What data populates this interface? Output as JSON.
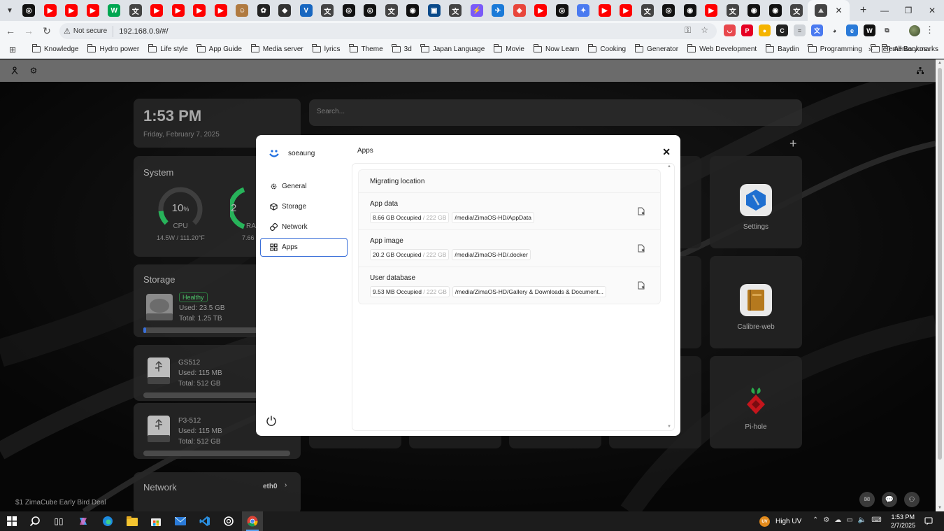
{
  "browser": {
    "pinned_tabs": [
      {
        "icon": "chatgpt-icon",
        "color": "#111111"
      },
      {
        "icon": "youtube-icon",
        "color": "#ff0000"
      },
      {
        "icon": "youtube-icon",
        "color": "#ff0000"
      },
      {
        "icon": "youtube-icon",
        "color": "#ff0000"
      },
      {
        "icon": "webtoon-icon",
        "color": "#00a651"
      },
      {
        "icon": "kanji-icon",
        "color": "#444444"
      },
      {
        "icon": "youtube-icon",
        "color": "#ff0000"
      },
      {
        "icon": "youtube-icon",
        "color": "#ff0000"
      },
      {
        "icon": "youtube-icon",
        "color": "#ff0000"
      },
      {
        "icon": "youtube-icon",
        "color": "#ff0000"
      },
      {
        "icon": "avatar-icon",
        "color": "#b07a40"
      },
      {
        "icon": "openai-icon",
        "color": "#222222"
      },
      {
        "icon": "cat-icon",
        "color": "#333333"
      },
      {
        "icon": "vuetify-icon",
        "color": "#1867c0"
      },
      {
        "icon": "kanji-icon",
        "color": "#444444"
      },
      {
        "icon": "chatgpt-icon",
        "color": "#111111"
      },
      {
        "icon": "chatgpt-icon",
        "color": "#111111"
      },
      {
        "icon": "kanji-icon",
        "color": "#444444"
      },
      {
        "icon": "github-icon",
        "color": "#111111"
      },
      {
        "icon": "screen-icon",
        "color": "#0a4a8a"
      },
      {
        "icon": "kanji-icon",
        "color": "#444444"
      },
      {
        "icon": "vite-icon",
        "color": "#7a5af8"
      },
      {
        "icon": "fly-icon",
        "color": "#1a7ad8"
      },
      {
        "icon": "red-app-icon",
        "color": "#e8463b"
      },
      {
        "icon": "youtube-icon",
        "color": "#ff0000"
      },
      {
        "icon": "chatgpt-icon",
        "color": "#111111"
      },
      {
        "icon": "gemini-icon",
        "color": "#4a7af0"
      },
      {
        "icon": "youtube-icon",
        "color": "#ff0000"
      },
      {
        "icon": "youtube-icon",
        "color": "#ff0000"
      },
      {
        "icon": "kanji-icon",
        "color": "#444444"
      },
      {
        "icon": "chatgpt-icon",
        "color": "#111111"
      },
      {
        "icon": "github-icon",
        "color": "#111111"
      },
      {
        "icon": "youtube-icon",
        "color": "#ff0000"
      },
      {
        "icon": "kanji-icon",
        "color": "#444444"
      },
      {
        "icon": "github-icon",
        "color": "#111111"
      },
      {
        "icon": "github-icon",
        "color": "#111111"
      },
      {
        "icon": "kanji-icon",
        "color": "#444444"
      }
    ],
    "security_label": "Not secure",
    "url": "192.168.0.9/#/",
    "bookmarks": [
      "Knowledge",
      "Hydro power",
      "Life style",
      "App Guide",
      "Media server",
      "lyrics",
      "Theme",
      "3d",
      "Japan Language",
      "Movie",
      "Now Learn",
      "Cooking",
      "Generator",
      "Web Development",
      "Baydin",
      "Programming",
      "elementary os"
    ],
    "all_bookmarks": "All Bookmarks",
    "more": "»"
  },
  "dashboard": {
    "time": "1:53 PM",
    "date": "Friday, February 7, 2025",
    "search_placeholder": "Search...",
    "system": {
      "title": "System",
      "cpu_value": "10",
      "cpu_unit": "%",
      "cpu_label": "CPU",
      "cpu_percent": 10,
      "cpu_sub": "14.5W / 111.20°F",
      "ram_value": "2",
      "ram_label": "RA",
      "ram_sub": "7.66"
    },
    "storage": {
      "title": "Storage",
      "status": "Healthy",
      "used": "Used: 23.5 GB",
      "total": "Total: 1.25 TB",
      "used_fraction": 0.02
    },
    "usb": [
      {
        "name": "GS512",
        "used": "Used: 115 MB",
        "total": "Total: 512 GB"
      },
      {
        "name": "P3-512",
        "used": "Used: 115 MB",
        "total": "Total: 512 GB"
      }
    ],
    "network": {
      "title": "Network",
      "iface": "eth0"
    },
    "apps": [
      {
        "label": "Settings"
      },
      {
        "label": "Calibre-web"
      },
      {
        "label": "Pi-hole"
      }
    ],
    "promo": "$1 ZimaCube Early Bird Deal"
  },
  "modal": {
    "username": "soeaung",
    "nav": [
      {
        "label": "General",
        "icon": "gear-icon"
      },
      {
        "label": "Storage",
        "icon": "cube-icon"
      },
      {
        "label": "Network",
        "icon": "link-icon"
      },
      {
        "label": "Apps",
        "icon": "grid-icon",
        "active": true
      }
    ],
    "title": "Apps",
    "migrating_title": "Migrating location",
    "rows": [
      {
        "name": "App data",
        "occupied": "8.66 GB Occupied",
        "total": "/ 222 GB",
        "path": "/media/ZimaOS-HD/AppData"
      },
      {
        "name": "App image",
        "occupied": "20.2 GB Occupied",
        "total": "/ 222 GB",
        "path": "/media/ZimaOS-HD/.docker"
      },
      {
        "name": "User database",
        "occupied": "9.53 MB Occupied",
        "total": "/ 222 GB",
        "path": "/media/ZimaOS-HD/Gallery & Downloads & Document..."
      }
    ]
  },
  "taskbar": {
    "weather": "High UV",
    "uv_badge": "UV",
    "time": "1:53 PM",
    "date": "2/7/2025"
  }
}
